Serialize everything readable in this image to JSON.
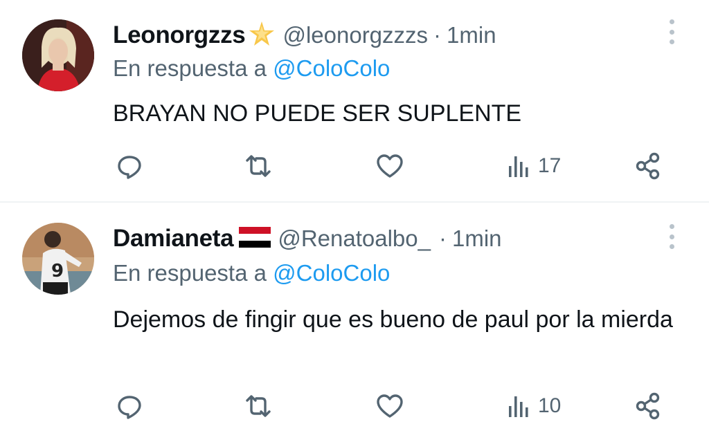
{
  "tweets": [
    {
      "display_name": "Leonorgzzs",
      "name_emoji": "sparkle-star",
      "handle": "@leonorgzzzs",
      "separator": "·",
      "time": "1min",
      "reply_prefix": "En respuesta a",
      "reply_target": "@ColoColo",
      "text": "BRAYAN NO PUEDE SER SUPLENTE",
      "views": "17",
      "icons": [
        "reply-icon",
        "retweet-icon",
        "like-icon",
        "views-icon",
        "share-icon"
      ]
    },
    {
      "display_name": "Damianeta",
      "name_emoji": "yemen-flag",
      "handle": "@Renatoalbo_",
      "separator": "·",
      "time": "1min",
      "reply_prefix": "En respuesta a",
      "reply_target": "@ColoColo",
      "text": "Dejemos de fingir que es bueno de paul por la mierda",
      "views": "10",
      "icons": [
        "reply-icon",
        "retweet-icon",
        "like-icon",
        "views-icon",
        "share-icon"
      ]
    }
  ],
  "colors": {
    "text_primary": "#0f1419",
    "text_secondary": "#536471",
    "link": "#1d9bf0",
    "divider": "#eff3f4"
  }
}
